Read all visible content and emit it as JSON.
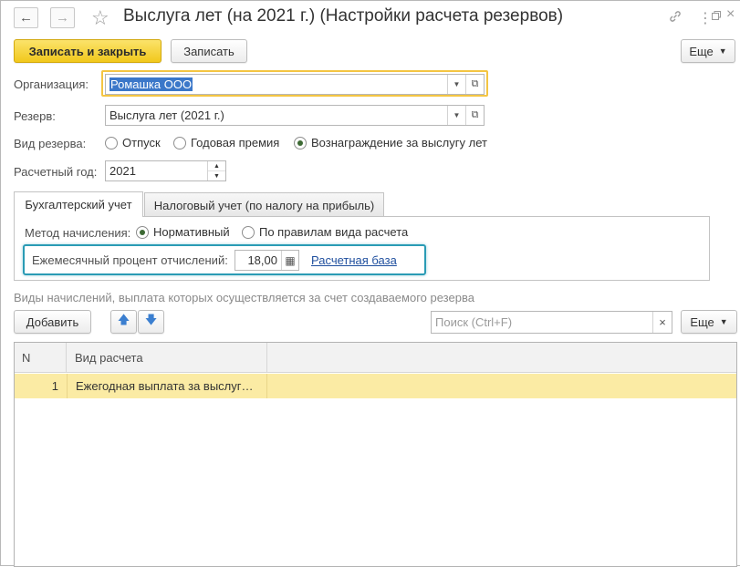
{
  "window": {
    "title": "Выслуга лет (на 2021 г.) (Настройки расчета резервов)",
    "back_icon": "arrow-left-icon",
    "forward_icon": "arrow-right-icon",
    "star_icon": "star-icon",
    "link_icon": "link-icon",
    "menu_icon": "more-icon",
    "restore_icon": "restore-icon",
    "close_icon": "close-icon"
  },
  "toolbar": {
    "save_close_label": "Записать и закрыть",
    "save_label": "Записать",
    "more_label": "Еще"
  },
  "form": {
    "org_label": "Организация:",
    "org_value": "Ромашка ООО",
    "reserve_label": "Резерв:",
    "reserve_value": "Выслуга лет (2021 г.)",
    "reserve_type_label": "Вид резерва:",
    "reserve_types": [
      "Отпуск",
      "Годовая премия",
      "Вознаграждение за выслугу лет"
    ],
    "reserve_type_selected": "Вознаграждение за выслугу лет",
    "year_label": "Расчетный год:",
    "year_value": "2021"
  },
  "tabs": {
    "accounting": "Бухгалтерский учет",
    "tax": "Налоговый учет (по налогу на прибыль)"
  },
  "accounting": {
    "method_label": "Метод начисления:",
    "methods": [
      "Нормативный",
      "По правилам вида расчета"
    ],
    "method_selected": "Нормативный",
    "monthly_percent_label": "Ежемесячный процент отчислений:",
    "monthly_percent_value": "18,00",
    "base_link": "Расчетная база"
  },
  "accruals": {
    "section_title": "Виды начислений, выплата которых осуществляется за счет создаваемого резерва",
    "add_label": "Добавить",
    "search_placeholder": "Поиск (Ctrl+F)",
    "more_label": "Еще",
    "columns": [
      "N",
      "Вид расчета"
    ],
    "rows": [
      {
        "n": "1",
        "kind": "Ежегодная выплата за выслуг…"
      }
    ]
  },
  "colors": {
    "highlight_org": "#f4c542",
    "highlight_percent": "#2a9bb5",
    "selected_row": "#fbeba4",
    "primary_button": "#f1c81c"
  }
}
